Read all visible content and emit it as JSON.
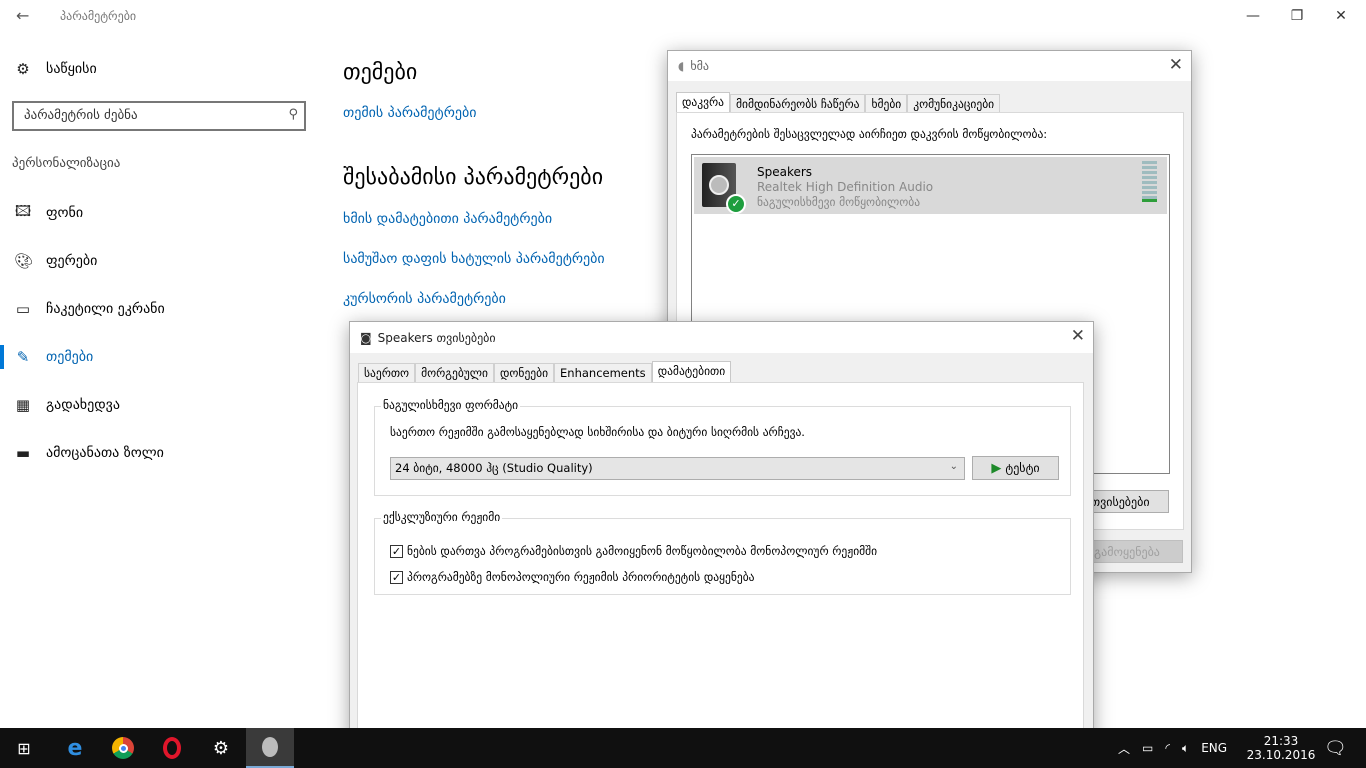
{
  "settings": {
    "title": "პარამეტრები",
    "home": "საწყისი",
    "search_placeholder": "პარამეტრის ძებნა",
    "section": "პერსონალიზაცია",
    "nav": [
      {
        "label": "ფონი",
        "icon": "picture-icon"
      },
      {
        "label": "ფერები",
        "icon": "palette-icon"
      },
      {
        "label": "ჩაკეტილი ეკრანი",
        "icon": "lock-screen-icon"
      },
      {
        "label": "თემები",
        "icon": "themes-icon"
      },
      {
        "label": "გადახედვა",
        "icon": "start-icon"
      },
      {
        "label": "ამოცანათა ზოლი",
        "icon": "taskbar-icon"
      }
    ],
    "heading": "თემები",
    "theme_link": "თემის პარამეტრები",
    "related_heading": "შესაბამისი პარამეტრები",
    "related_links": [
      "ხმის დამატებითი პარამეტრები",
      "სამუშაო დაფის ხატულის პარამეტრები",
      "კურსორის პარამეტრები"
    ]
  },
  "sound": {
    "title": "ხმა",
    "tabs": [
      "დაკვრა",
      "მიმდინარეობს ჩაწერა",
      "ხმები",
      "კომუნიკაციები"
    ],
    "instruction": "პარამეტრების შესაცვლელად აირჩიეთ დაკვრის მოწყობილობა:",
    "device": {
      "name": "Speakers",
      "driver": "Realtek High Definition Audio",
      "status": "ნაგულისხმევი მოწყობილობა"
    },
    "properties_button": "თვისებები",
    "apply_button": "გამოყენება"
  },
  "speakers": {
    "title": "Speakers თვისებები",
    "tabs": [
      "საერთო",
      "მორგებული",
      "დონეები",
      "Enhancements",
      "დამატებითი"
    ],
    "format_group": "ნაგულისხმევი ფორმატი",
    "format_desc": "საერთო რეჟიმში გამოსაყენებლად სიხშირისა და ბიტური სიღრმის არჩევა.",
    "format_value": "24 ბიტი, 48000 ჰც (Studio Quality)",
    "test_button": "ტესტი",
    "exclusive_group": "ექსკლუზიური რეჟიმი",
    "checks": [
      {
        "label": "ნების დართვა პროგრამებისთვის გამოიყენონ მოწყობილობა მონოპოლიურ რეჟიმში",
        "checked": true
      },
      {
        "label": "პროგრამებზე მონოპოლიური რეჟიმის პრიორიტეტის დაყენება",
        "checked": true
      }
    ]
  },
  "tray": {
    "lang": "ENG",
    "time": "21:33",
    "date": "23.10.2016"
  }
}
